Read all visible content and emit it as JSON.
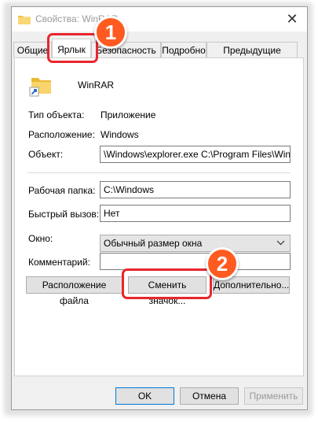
{
  "window": {
    "title": "Свойства: WinRAR",
    "close_glyph": "✕"
  },
  "tabs": [
    {
      "label": "Общие"
    },
    {
      "label": "Ярлык"
    },
    {
      "label": "Безопасность"
    },
    {
      "label": "Подробно"
    },
    {
      "label": "Предыдущие версии"
    }
  ],
  "app": {
    "name": "WinRAR",
    "icon": "folder-shortcut-icon"
  },
  "info": {
    "type_label": "Тип объекта:",
    "type_value": "Приложение",
    "location_label": "Расположение:",
    "location_value": "Windows",
    "target_label": "Объект:",
    "target_value": "\\Windows\\explorer.exe C:\\Program Files\\WinRAR"
  },
  "fields": {
    "workdir_label": "Рабочая папка:",
    "workdir_value": "C:\\Windows",
    "hotkey_label": "Быстрый вызов:",
    "hotkey_value": "Нет",
    "window_label": "Окно:",
    "window_value": "Обычный размер окна",
    "comment_label": "Комментарий:",
    "comment_value": ""
  },
  "buttons": {
    "file_location": "Расположение файла",
    "change_icon": "Сменить значок...",
    "advanced": "Дополнительно...",
    "ok": "OK",
    "cancel": "Отмена",
    "apply": "Применить"
  },
  "annotations": {
    "step1": "1",
    "step2": "2",
    "highlight_color": "#e8262d",
    "badge_color": "#ff5a1f"
  }
}
